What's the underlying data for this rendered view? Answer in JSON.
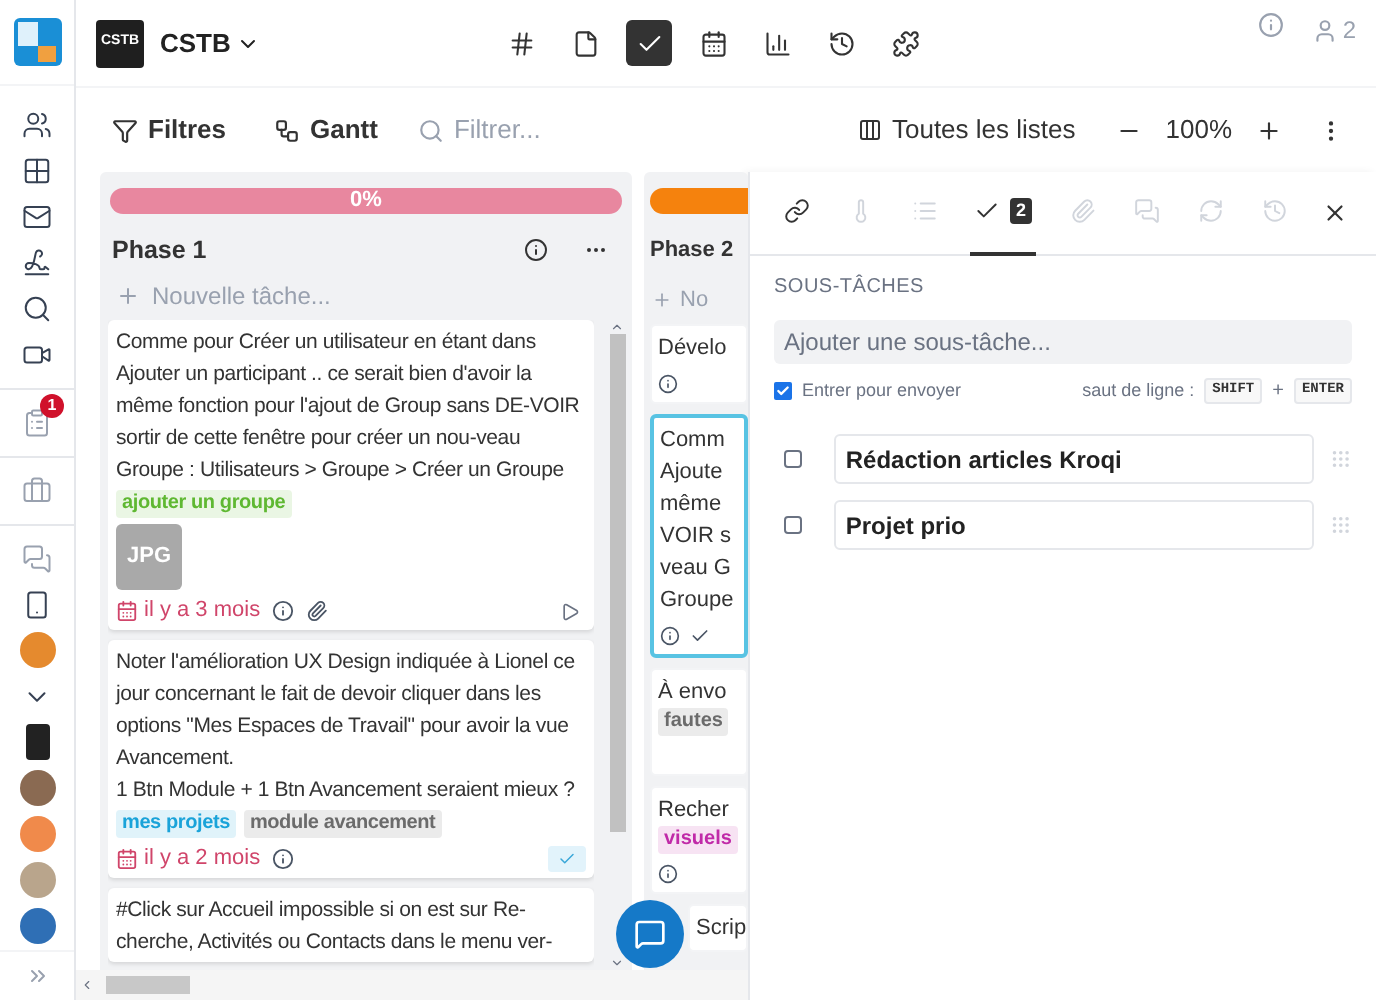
{
  "workspace": {
    "logo_text": "CSTB",
    "name": "CSTB"
  },
  "top_tabs": [
    {
      "kind": "hash",
      "selected": false
    },
    {
      "kind": "file",
      "selected": false
    },
    {
      "kind": "check",
      "selected": true
    },
    {
      "kind": "calendar",
      "selected": false
    },
    {
      "kind": "chart",
      "selected": false
    },
    {
      "kind": "history",
      "selected": false
    },
    {
      "kind": "puzzle",
      "selected": false
    }
  ],
  "user_count": "2",
  "rail": [
    {
      "kind": "people"
    },
    {
      "kind": "grid"
    },
    {
      "kind": "mail"
    },
    {
      "kind": "signature"
    },
    {
      "kind": "search"
    },
    {
      "kind": "video"
    },
    {
      "kind": "divider"
    },
    {
      "kind": "clipboard",
      "badge": "1"
    },
    {
      "kind": "divider"
    },
    {
      "kind": "briefcase"
    },
    {
      "kind": "divider"
    },
    {
      "kind": "chat"
    },
    {
      "kind": "phone"
    },
    {
      "kind": "avatar",
      "color": "#e58a2e"
    },
    {
      "kind": "chevron"
    },
    {
      "kind": "logo"
    },
    {
      "kind": "avatar",
      "color": "#8a6a52"
    },
    {
      "kind": "avatar",
      "color": "#f08a4b"
    },
    {
      "kind": "avatar",
      "color": "#b9a58c"
    },
    {
      "kind": "avatar",
      "color": "#2f6fb5"
    }
  ],
  "toolbar": {
    "filters": "Filtres",
    "gantt": "Gantt",
    "search_placeholder": "Filtrer...",
    "lists": "Toutes les listes",
    "zoom": "100%"
  },
  "columns": [
    {
      "title": "Phase 1",
      "progress": "0%",
      "color": "#e8879f",
      "new_task": "Nouvelle tâche...",
      "cards": [
        {
          "text": "Comme pour Créer un utilisateur en étant dans Ajouter un participant .. ce serait bien d'avoir la même fonction pour l'ajout de Group sans DE-VOIR sortir de cette fenêtre pour créer un nou-veau Groupe :  Utilisateurs > Groupe > Créer un Groupe",
          "tags": [
            {
              "label": "ajouter un groupe",
              "color": "#5fb832"
            }
          ],
          "attachment": "JPG",
          "date": "il y a 3 mois",
          "has_clip": true,
          "done": false
        },
        {
          "text": "Noter l'amélioration UX Design indiquée à Lionel ce jour concernant le fait de devoir cliquer dans les options \"Mes Espaces de Travail\" pour avoir la vue Avancement.\n1 Btn Module + 1 Btn Avancement seraient mieux ?",
          "tags": [
            {
              "label": "mes projets",
              "color": "#1aa3d9"
            },
            {
              "label": "module avancement",
              "color": "#6b6b6b"
            }
          ],
          "date": "il y a 2 mois",
          "has_clip": false,
          "done": true
        },
        {
          "text": "#Click sur Accueil impossible si on est sur Re-cherche, Activités ou Contacts dans le menu ver-"
        }
      ]
    },
    {
      "title": "Phase 2",
      "color": "#f5820d",
      "new_task": "No",
      "cards": [
        {
          "text": "Dévelo",
          "info": true,
          "done": false,
          "selected": false
        },
        {
          "text": "Comm\nAjoute\nmême\nVOIR s\nveau G\nGroupe",
          "info": true,
          "done": true,
          "selected": true
        },
        {
          "text": "À envo",
          "tags": [
            {
              "label": "fautes",
              "color": "#6b6b6b"
            }
          ],
          "info": false,
          "done": false,
          "selected": false
        },
        {
          "text": "Recher",
          "tags": [
            {
              "label": "visuels",
              "color": "#c02aa8"
            }
          ],
          "info": true,
          "done": false,
          "selected": false
        },
        {
          "text": "Scrip",
          "selected": false
        }
      ]
    }
  ],
  "panel": {
    "tabs": [
      {
        "kind": "link",
        "selected": false,
        "disabled": false
      },
      {
        "kind": "thermometer",
        "selected": false,
        "disabled": true
      },
      {
        "kind": "list",
        "selected": false,
        "disabled": true
      },
      {
        "kind": "check",
        "count": "2",
        "selected": true,
        "disabled": false
      },
      {
        "kind": "paperclip",
        "selected": false,
        "disabled": true
      },
      {
        "kind": "chat",
        "selected": false,
        "disabled": true
      },
      {
        "kind": "refresh",
        "selected": false,
        "disabled": true
      },
      {
        "kind": "history",
        "selected": false,
        "disabled": true
      }
    ],
    "section_title": "SOUS-TÂCHES",
    "input_placeholder": "Ajouter une sous-tâche...",
    "send_on_enter": {
      "label": "Entrer pour envoyer",
      "checked": true
    },
    "line_break_hint": "saut de ligne :",
    "keys": [
      "SHIFT",
      "ENTER"
    ],
    "plus_sign": "+",
    "subtasks": [
      {
        "title": "Rédaction articles Kroqi",
        "checked": false
      },
      {
        "title": "Projet prio",
        "checked": false
      }
    ]
  }
}
